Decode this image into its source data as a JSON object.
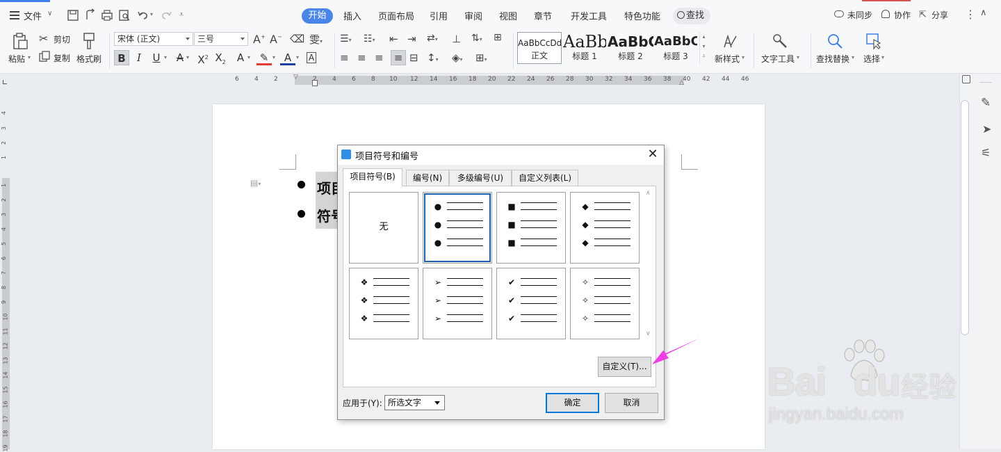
{
  "menubar": {
    "file_label": "文件",
    "tabs": [
      "开始",
      "插入",
      "页面布局",
      "引用",
      "审阅",
      "视图",
      "章节",
      "开发工具",
      "特色功能"
    ],
    "search_label": "查找",
    "sync_label": "未同步",
    "collab_label": "协作",
    "share_label": "分享"
  },
  "ribbon": {
    "paste_label": "粘贴",
    "cut_label": "剪切",
    "copy_label": "复制",
    "format_painter_label": "格式刷",
    "font_name": "宋体 (正文)",
    "font_size": "三号",
    "styles": [
      {
        "sample": "AaBbCcDd",
        "name": "正文"
      },
      {
        "sample": "AaBb",
        "name": "标题 1"
      },
      {
        "sample": "AaBbC",
        "name": "标题 2"
      },
      {
        "sample": "AaBbC",
        "name": "标题 3"
      }
    ],
    "new_style_label": "新样式",
    "text_tools_label": "文字工具",
    "find_replace_label": "查找替换",
    "select_label": "选择"
  },
  "hruler": {
    "ticks": [
      "6",
      "4",
      "2",
      "2",
      "4",
      "6",
      "8",
      "10",
      "12",
      "14",
      "16",
      "18",
      "20",
      "22",
      "24",
      "26",
      "28",
      "30",
      "32",
      "34",
      "36",
      "38",
      "40",
      "42",
      "44",
      "46"
    ]
  },
  "vruler": {
    "ticks": [
      "4",
      "3",
      "2",
      "1",
      "1",
      "2",
      "3",
      "4",
      "5",
      "6",
      "7",
      "8",
      "9",
      "10",
      "11",
      "12",
      "13",
      "14",
      "15",
      "16",
      "17",
      "18",
      "19"
    ]
  },
  "document": {
    "lines": [
      "项目",
      "符号"
    ]
  },
  "dialog": {
    "title": "项目符号和编号",
    "tabs": [
      "项目符号(B)",
      "编号(N)",
      "多级编号(U)",
      "自定义列表(L)"
    ],
    "active_tab": "项目符号(B)",
    "none_label": "无",
    "bullet_styles": [
      {
        "name": "none"
      },
      {
        "name": "filled-circle",
        "symbol": "●"
      },
      {
        "name": "filled-square",
        "symbol": "■"
      },
      {
        "name": "filled-diamond",
        "symbol": "◆"
      },
      {
        "name": "diamond-cluster",
        "symbol": "❖"
      },
      {
        "name": "arrowhead",
        "symbol": "➢"
      },
      {
        "name": "checkmark",
        "symbol": "✔"
      },
      {
        "name": "four-point-star",
        "symbol": "✧"
      }
    ],
    "selected_style": "filled-circle",
    "customize_label": "自定义(T)...",
    "apply_to_label": "应用于(Y):",
    "apply_to_value": "所选文字",
    "ok_label": "确定",
    "cancel_label": "取消"
  },
  "watermark": {
    "brand": "Bai",
    "brand_tail": "du",
    "brand_cn": "经验",
    "url": "jingyan.baidu.com"
  },
  "colors": {
    "accent": "#4a86e8",
    "selection_border": "#1a5fb4",
    "arrow": "#ee3ee6",
    "primary_button_border": "#0078d7"
  }
}
